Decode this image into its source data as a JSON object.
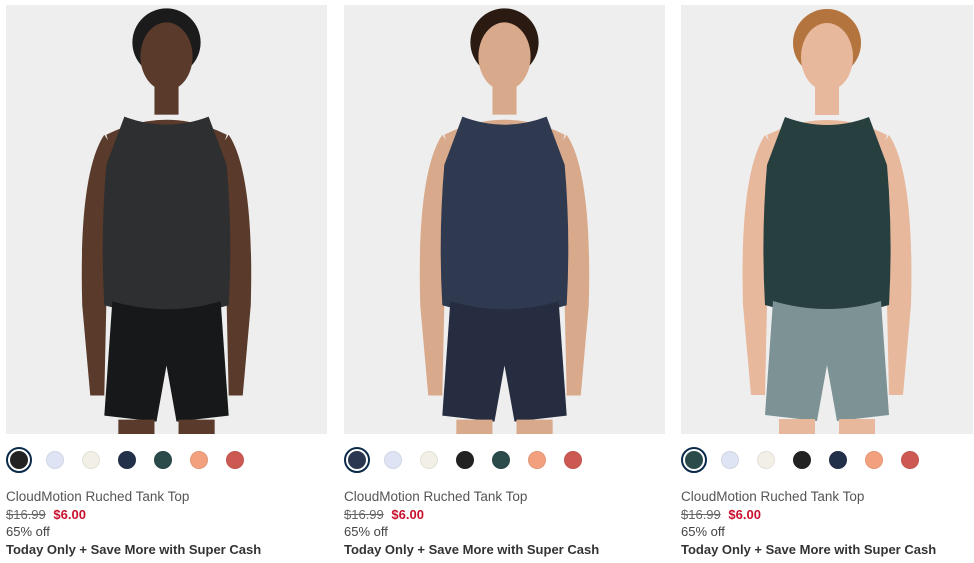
{
  "products": [
    {
      "name": "CloudMotion Ruched Tank Top",
      "original_price": "$16.99",
      "sale_price": "$6.00",
      "discount": "65% off",
      "promo": "Today Only + Save More with Super Cash",
      "model": {
        "skin": "#5a3a2a",
        "hair": "#1b1b1b",
        "top": "#2e2f31",
        "bottom": "#17181a"
      },
      "swatches": [
        "#222222",
        "#dfe4f4",
        "#f2efe6",
        "#233049",
        "#2b4a4a",
        "#f2a07e",
        "#cc5a52"
      ],
      "selected_swatch": 0
    },
    {
      "name": "CloudMotion Ruched Tank Top",
      "original_price": "$16.99",
      "sale_price": "$6.00",
      "discount": "65% off",
      "promo": "Today Only + Save More with Super Cash",
      "model": {
        "skin": "#d8a98a",
        "hair": "#2a1a12",
        "top": "#2f3a51",
        "bottom": "#262d40"
      },
      "swatches": [
        "#2b3650",
        "#dfe4f4",
        "#f2efe6",
        "#222222",
        "#2b4a4a",
        "#f2a07e",
        "#cc5a52"
      ],
      "selected_swatch": 0
    },
    {
      "name": "CloudMotion Ruched Tank Top",
      "original_price": "$16.99",
      "sale_price": "$6.00",
      "discount": "65% off",
      "promo": "Today Only + Save More with Super Cash",
      "model": {
        "skin": "#e7b89c",
        "hair": "#b4743e",
        "top": "#27403f",
        "bottom": "#7c9294"
      },
      "swatches": [
        "#2b4a4a",
        "#dfe4f4",
        "#f2efe6",
        "#222222",
        "#233049",
        "#f2a07e",
        "#cc5a52"
      ],
      "selected_swatch": 0
    }
  ]
}
